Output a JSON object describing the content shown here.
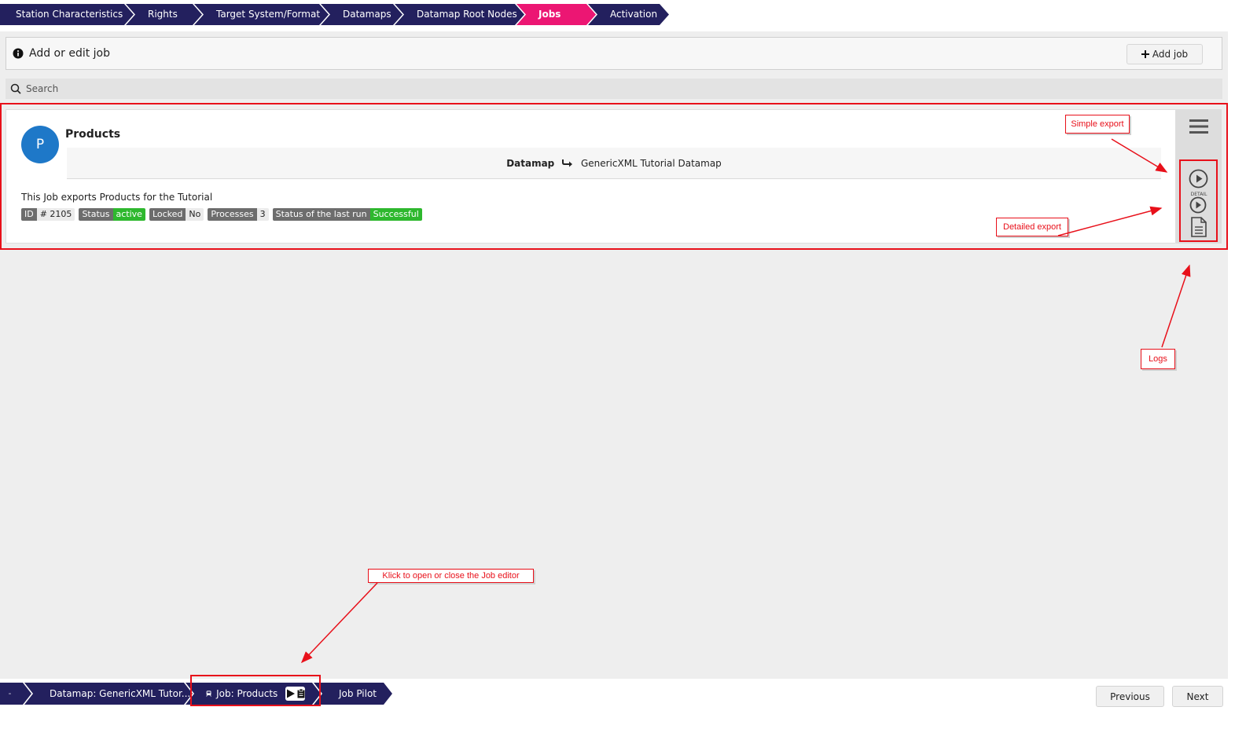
{
  "wizard": {
    "steps": [
      {
        "label": "Station Characteristics"
      },
      {
        "label": "Rights"
      },
      {
        "label": "Target System/Format"
      },
      {
        "label": "Datamaps"
      },
      {
        "label": "Datamap Root Nodes"
      },
      {
        "label": "Jobs"
      },
      {
        "label": "Activation"
      }
    ],
    "active_index": 5,
    "colors": {
      "step": "#23205e",
      "active": "#ec1673"
    }
  },
  "edit_bar": {
    "title": "Add or edit job",
    "add_button": "Add job"
  },
  "search": {
    "placeholder": "Search"
  },
  "job": {
    "avatar_letter": "P",
    "name": "Products",
    "datamap_label": "Datamap",
    "datamap_value": "GenericXML Tutorial Datamap",
    "description": "This Job exports Products for the Tutorial",
    "badges": [
      {
        "key": "ID",
        "value": "# 2105"
      },
      {
        "key": "Status",
        "value": "active",
        "highlight": true
      },
      {
        "key": "Locked",
        "value": "No"
      },
      {
        "key": "Processes",
        "value": "3"
      },
      {
        "key": "Status of the last run",
        "value": "Successful",
        "highlight": true
      }
    ],
    "actions": {
      "detail_text": "DETAIL"
    }
  },
  "breadcrumbs": [
    {
      "label": ""
    },
    {
      "label": "Datamap: GenericXML Tutor..."
    },
    {
      "label": "Job: Products"
    },
    {
      "label": "Job Pilot"
    }
  ],
  "nav": {
    "previous": "Previous",
    "next": "Next"
  },
  "annotations": {
    "simple_export": "Simple export",
    "detailed_export": "Detailed export",
    "logs": "Logs",
    "job_editor": "Klick to open or close the Job editor",
    "color": "#e8101a"
  }
}
